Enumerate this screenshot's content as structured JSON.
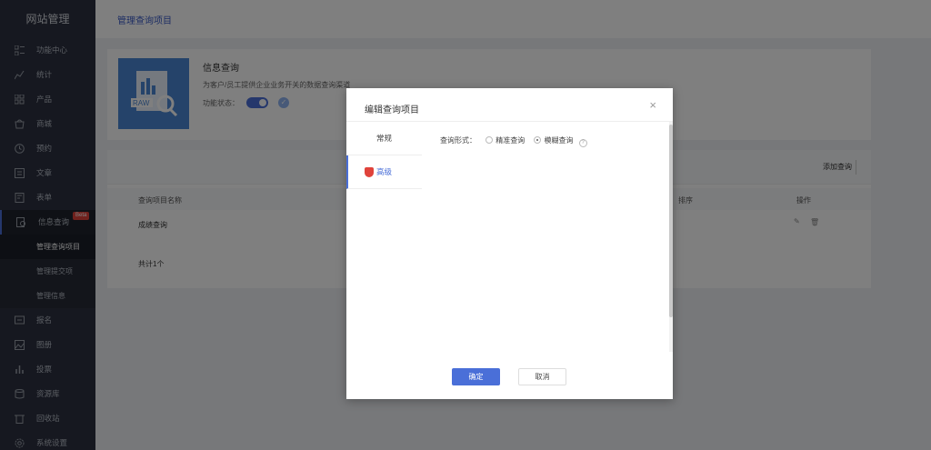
{
  "sidebar": {
    "brand": "网站管理",
    "items": [
      {
        "label": "功能中心",
        "icon": "grid-icon"
      },
      {
        "label": "统计",
        "icon": "stats-icon"
      },
      {
        "label": "产品",
        "icon": "product-icon"
      },
      {
        "label": "商城",
        "icon": "shop-icon"
      },
      {
        "label": "预约",
        "icon": "clock-icon"
      },
      {
        "label": "文章",
        "icon": "article-icon"
      },
      {
        "label": "表单",
        "icon": "form-icon"
      },
      {
        "label": "信息查询",
        "icon": "query-icon",
        "badge": "Beta"
      },
      {
        "label": "报名",
        "icon": "signup-icon"
      },
      {
        "label": "图册",
        "icon": "gallery-icon"
      },
      {
        "label": "投票",
        "icon": "vote-icon"
      },
      {
        "label": "资源库",
        "icon": "database-icon"
      },
      {
        "label": "回收站",
        "icon": "trash-icon"
      },
      {
        "label": "系统设置",
        "icon": "settings-icon"
      }
    ],
    "sub_items": [
      "管理查询项目",
      "管理提交项",
      "管理信息"
    ]
  },
  "header": {
    "title": "管理查询项目"
  },
  "info_card": {
    "name": "信息查询",
    "description": "为客户/员工提供企业业务开关的数据查询渠道",
    "status_label": "功能状态："
  },
  "table": {
    "add_button": "添加查询",
    "columns": [
      "查询项目名称",
      "排序",
      "操作"
    ],
    "rows": [
      {
        "name": "成绩查询"
      }
    ],
    "total": "共计1个"
  },
  "modal": {
    "title": "编辑查询项目",
    "close": "×",
    "tabs": [
      "常规",
      "高级"
    ],
    "form": {
      "label": "查询形式：",
      "options": [
        "精准查询",
        "模糊查询"
      ],
      "selected": "模糊查询",
      "help": "?"
    },
    "ok_label": "确定",
    "cancel_label": "取消"
  },
  "colors": {
    "accent": "#4a6fd8",
    "sidebar_bg": "#2c3140",
    "badge": "#e0433b"
  }
}
